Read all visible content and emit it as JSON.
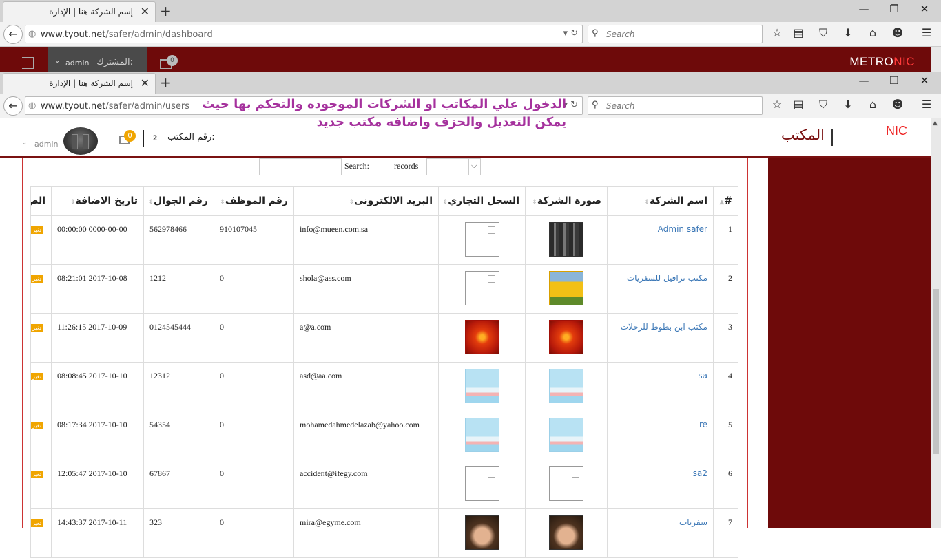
{
  "browser1": {
    "tab_title": "إسم الشركة هنا | الإدارة",
    "url_host": "www.tyout.net",
    "url_path": "/safer/admin/dashboard",
    "search_placeholder": "Search"
  },
  "adminbar": {
    "subscriber_label": "المشترك:",
    "user_name": "admin",
    "notifications_count": "0",
    "logo_part1": "METRO",
    "logo_part2": "NIC"
  },
  "browser2": {
    "tab_title": "إسم الشركة هنا | الإدارة",
    "url_host": "www.tyout.net",
    "url_path": "/safer/admin/users",
    "search_placeholder": "Search"
  },
  "overlay_note": "الدخول علي المكاتب او الشركات الموجوده والتحكم بها حيث يمكن التعديل والحزف واضافه مكتب جديد",
  "header": {
    "brand_nic": "NIC",
    "brand_title": "المكتب",
    "user_name": "admin",
    "notifications_count": "0",
    "office_number_label": "رقم المكتب:",
    "office_number_value": "2"
  },
  "table_controls": {
    "search_label": "Search:",
    "records_label": "records"
  },
  "table": {
    "headers": [
      "#",
      "اسم الشركة",
      "صورة الشركة",
      "السجل التجاري",
      "البريد الالكترونى",
      "رقم الموظف",
      "رقم الجوال",
      "تاريخ الاضافة",
      "الص"
    ],
    "edit_label": "تغير",
    "rows": [
      {
        "n": "1",
        "name": "Admin safer",
        "img": "dark",
        "reg": "blank",
        "email": "info@mueen.com.sa",
        "emp": "910107045",
        "mobile": "562978466",
        "date": "0000-00-00 00:00:00"
      },
      {
        "n": "2",
        "name": "مكتب ترافيل للسفريات",
        "img": "tulips",
        "reg": "blank",
        "email": "shola@ass.com",
        "emp": "0",
        "mobile": "1212",
        "date": "2017-10-08 08:21:01"
      },
      {
        "n": "3",
        "name": "مكتب ابن بطوط للرحلات",
        "img": "flower",
        "reg": "flower",
        "email": "a@a.com",
        "emp": "0",
        "mobile": "0124545444",
        "date": "2017-10-09 11:26:15"
      },
      {
        "n": "4",
        "name": "sa",
        "img": "travel",
        "reg": "travel",
        "email": "asd@aa.com",
        "emp": "0",
        "mobile": "12312",
        "date": "2017-10-10 08:08:45"
      },
      {
        "n": "5",
        "name": "re",
        "img": "travel",
        "reg": "travel",
        "email": "mohamedahmedelazab@yahoo.com",
        "emp": "0",
        "mobile": "54354",
        "date": "2017-10-10 08:17:34"
      },
      {
        "n": "6",
        "name": "sa2",
        "img": "blank",
        "reg": "blank",
        "email": "accident@ifegy.com",
        "emp": "0",
        "mobile": "67867",
        "date": "2017-10-10 12:05:47"
      },
      {
        "n": "7",
        "name": "سفريات",
        "img": "face",
        "reg": "face",
        "email": "mira@egyme.com",
        "emp": "0",
        "mobile": "323",
        "date": "2017-10-11 14:43:37"
      }
    ]
  },
  "colors": {
    "brand_dark_red": "#6e0a0a",
    "link_blue": "#3b77b6",
    "note_purple": "#a5319d",
    "badge_orange": "#f0a500"
  }
}
